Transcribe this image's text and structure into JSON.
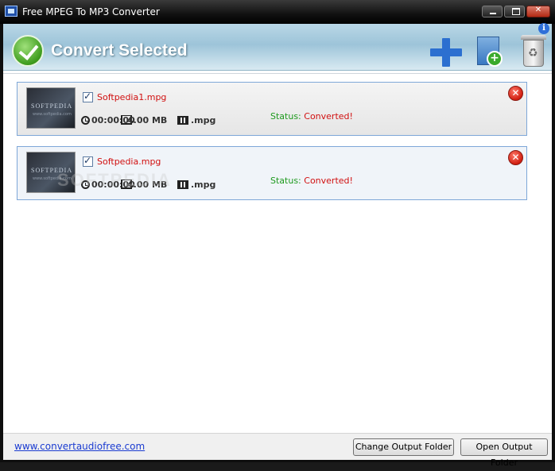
{
  "window": {
    "title": "Free MPEG To MP3 Converter"
  },
  "toolbar": {
    "convert_label": "Convert Selected",
    "icons": [
      "checkmark-icon",
      "add-icon",
      "add-folder-icon",
      "recycle-bin-icon",
      "info-icon"
    ]
  },
  "files": [
    {
      "name": "Softpedia1.mpg",
      "checked": true,
      "duration": "00:00:00",
      "size": "4.00 MB",
      "extension": ".mpg",
      "status_label": "Status:",
      "status_value": "Converted!",
      "thumb_brand": "SOFTPEDIA",
      "thumb_url": "www.softpedia.com"
    },
    {
      "name": "Softpedia.mpg",
      "checked": true,
      "duration": "00:00:00",
      "size": "4.00 MB",
      "extension": ".mpg",
      "status_label": "Status:",
      "status_value": "Converted!",
      "thumb_brand": "SOFTPEDIA",
      "thumb_url": "www.softpedia.com"
    }
  ],
  "footer": {
    "link": "www.convertaudiofree.com",
    "change_folder": "Change Output Folder",
    "open_folder": "Open Output Folder"
  },
  "watermark": "SOFTPEDIA",
  "colors": {
    "status_label": "#1e9a1e",
    "status_value": "#d11010",
    "filename": "#d11010",
    "link": "#1a3bd1",
    "item_border": "#7ea7d8"
  }
}
